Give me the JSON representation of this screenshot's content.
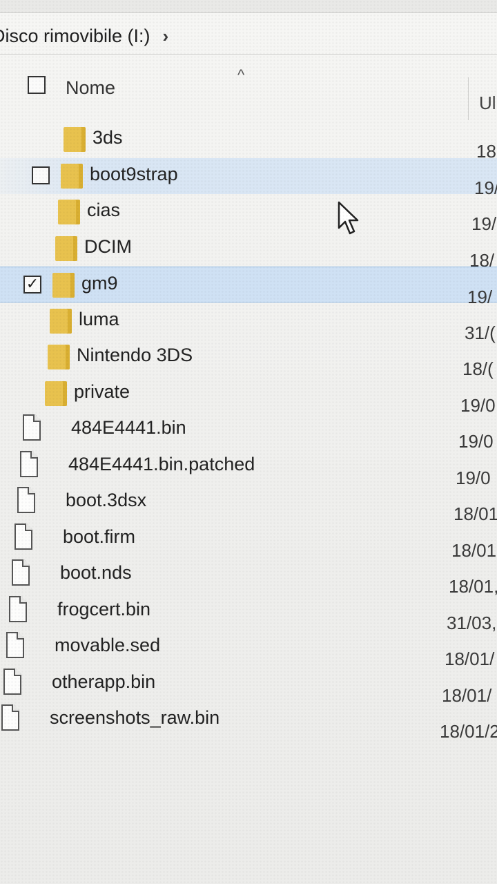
{
  "breadcrumb": {
    "drive": "Disco rimovibile (I:)",
    "chevron": "›"
  },
  "header": {
    "sort_arrow": "^",
    "name": "Nome",
    "date_partial": "Ul"
  },
  "files": [
    {
      "name": "3ds",
      "type": "folder",
      "date": "18"
    },
    {
      "name": "boot9strap",
      "type": "folder",
      "date": "19/",
      "hover": true
    },
    {
      "name": "cias",
      "type": "folder",
      "date": "19/"
    },
    {
      "name": "DCIM",
      "type": "folder",
      "date": "18/"
    },
    {
      "name": "gm9",
      "type": "folder",
      "date": "19/",
      "selected": true,
      "checkbox_mark": "✓"
    },
    {
      "name": "luma",
      "type": "folder",
      "date": "31/("
    },
    {
      "name": "Nintendo 3DS",
      "type": "folder",
      "date": "18/("
    },
    {
      "name": "private",
      "type": "folder",
      "date": "19/0"
    },
    {
      "name": "484E4441.bin",
      "type": "file",
      "date": "19/0"
    },
    {
      "name": "484E4441.bin.patched",
      "type": "file",
      "date": "19/0"
    },
    {
      "name": "boot.3dsx",
      "type": "file",
      "date": "18/01"
    },
    {
      "name": "boot.firm",
      "type": "file",
      "date": "18/01"
    },
    {
      "name": "boot.nds",
      "type": "file",
      "date": "18/01,"
    },
    {
      "name": "frogcert.bin",
      "type": "file",
      "date": "31/03,"
    },
    {
      "name": "movable.sed",
      "type": "file",
      "date": "18/01/"
    },
    {
      "name": "otherapp.bin",
      "type": "file",
      "date": "18/01/"
    },
    {
      "name": "screenshots_raw.bin",
      "type": "file",
      "date": "18/01/2"
    }
  ],
  "colors": {
    "folder": "#e8c24e",
    "selection": "#cfe1f4",
    "hover": "#d6e4f4"
  }
}
